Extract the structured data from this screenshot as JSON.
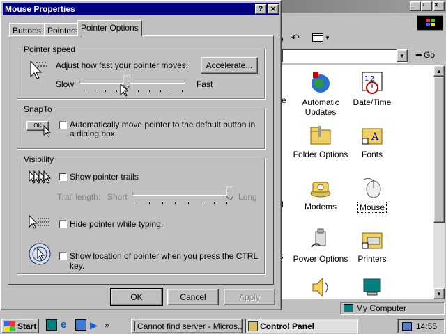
{
  "dialog": {
    "title": "Mouse Properties",
    "help_label": "?",
    "close_label": "×",
    "tabs": [
      "Buttons",
      "Pointers",
      "Pointer Options"
    ],
    "active_tab": "Pointer Options",
    "speed": {
      "group_label": "Pointer speed",
      "instruction": "Adjust how fast your pointer moves:",
      "slow": "Slow",
      "fast": "Fast",
      "accelerate_label": "Accelerate...",
      "value_fraction": 0.45
    },
    "snapto": {
      "group_label": "SnapTo",
      "mini_ok": "OK",
      "checkbox_label": "Automatically move pointer to the default button in a dialog box.",
      "checked": false
    },
    "visibility": {
      "group_label": "Visibility",
      "trails_label": "Show pointer trails",
      "trail_length_label": "Trail length:",
      "short": "Short",
      "long": "Long",
      "trail_fraction": 1.0,
      "hide_label": "Hide pointer while typing.",
      "ctrl_label": "Show location of pointer when you press the CTRL key."
    },
    "buttons": {
      "ok": "OK",
      "cancel": "Cancel",
      "apply": "Apply"
    }
  },
  "control_panel": {
    "title_buttons": [
      "_",
      "▫",
      "×"
    ],
    "go_label": "Go",
    "items": [
      {
        "label": "Automatic Updates",
        "icon": "globe-icon"
      },
      {
        "label": "Date/Time",
        "icon": "calendar-icon"
      },
      {
        "label": "Folder Options",
        "icon": "folder-icon"
      },
      {
        "label": "Fonts",
        "icon": "fonts-folder-icon"
      },
      {
        "label": "Modems",
        "icon": "modem-icon"
      },
      {
        "label": "Mouse",
        "icon": "mouse-icon"
      },
      {
        "label": "Power Options",
        "icon": "power-icon"
      },
      {
        "label": "Printers",
        "icon": "printer-folder-icon"
      }
    ],
    "partial_left_labels": [
      "ve",
      "d",
      "ls"
    ],
    "status_text": "My Computer"
  },
  "taskbar": {
    "start_label": "Start",
    "quicklaunch_more": "»",
    "tasks": [
      "Cannot find server - Micros...",
      "Control Panel"
    ],
    "active_task": "Control Panel",
    "clock": "14:55"
  },
  "colors": {
    "title_active": "#000080",
    "face": "#c0c0c0",
    "desktop_window": "#ffffff"
  }
}
